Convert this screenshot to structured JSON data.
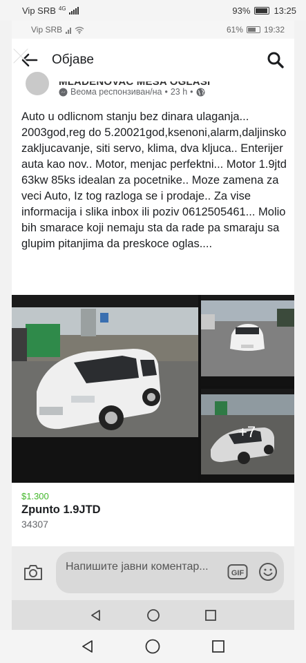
{
  "outer_status": {
    "carrier": "Vip SRB",
    "network": "4G",
    "battery": "93%",
    "time": "13:25"
  },
  "inner_status": {
    "carrier": "Vip SRB",
    "battery": "61%",
    "time": "19:32"
  },
  "appbar": {
    "title": "Објаве"
  },
  "post": {
    "page_name": "MLADENOVAC MESA OGLASI",
    "responsiveness": "Веома респонзиван/на",
    "time": "23 h",
    "text": "Auto u odlicnom stanju bez dinara ulaganja... 2003god,reg do 5.20021god,ksenoni,alarm,daljinsko zakljucavanje, siti servo, klima, dva kljuca.. Enterijer auta kao nov.. Motor, menjac perfektni...  Motor 1.9jtd 63kw 85ks idealan za pocetnike.. Moze zamena za veci Auto, Iz tog razloga se i prodaje.. Za vise informacija i slika inbox ili poziv 0612505461... Molio bih smarace koji nemaju sta da rade pa smaraju sa glupim pitanjima da preskoce oglas....",
    "more_photos": "+7"
  },
  "listing": {
    "price": "$1.300",
    "title": "Zpunto 1.9JTD",
    "subtitle": "34307"
  },
  "composer": {
    "placeholder": "Напишите јавни коментар...",
    "gif_label": "GIF"
  },
  "colors": {
    "price_green": "#42b72a",
    "meta_gray": "#65676b"
  }
}
